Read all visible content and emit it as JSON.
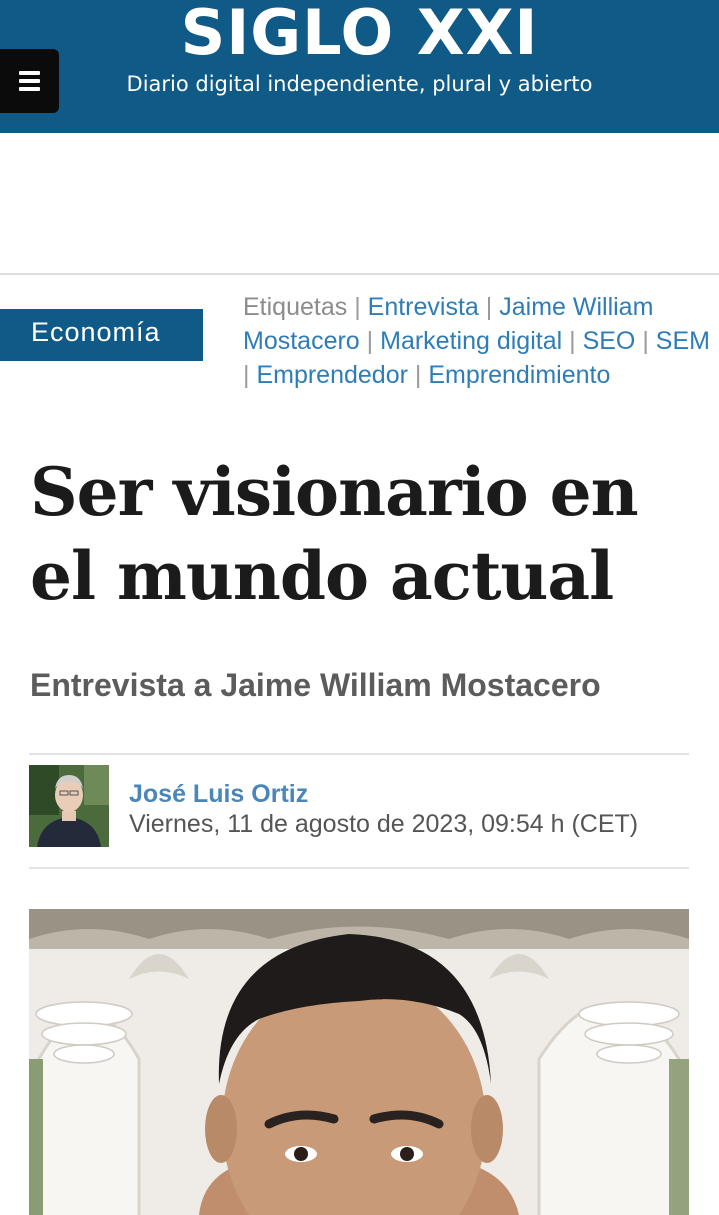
{
  "header": {
    "logo_title": "SIGLO XXI",
    "logo_subtitle": "Diario digital independiente, plural y abierto",
    "menu_icon": "hamburger-menu-icon",
    "background_color": "#0f5a86"
  },
  "article": {
    "section": "Economía",
    "tags_label": "Etiquetas",
    "tags": [
      "Entrevista",
      "Jaime William Mostacero",
      "Marketing digital",
      "SEO",
      "SEM",
      "Emprendedor",
      "Emprendimiento"
    ],
    "title": "Ser visionario en el mundo actual",
    "subtitle": "Entrevista a Jaime William Mostacero",
    "author": {
      "name": "José Luis Ortiz",
      "date": "Viernes, 11 de agosto de 2023, 09:54 h (CET)"
    }
  },
  "colors": {
    "brand": "#0f5a86",
    "link": "#2f7db6",
    "author_link": "#4a86b8"
  }
}
